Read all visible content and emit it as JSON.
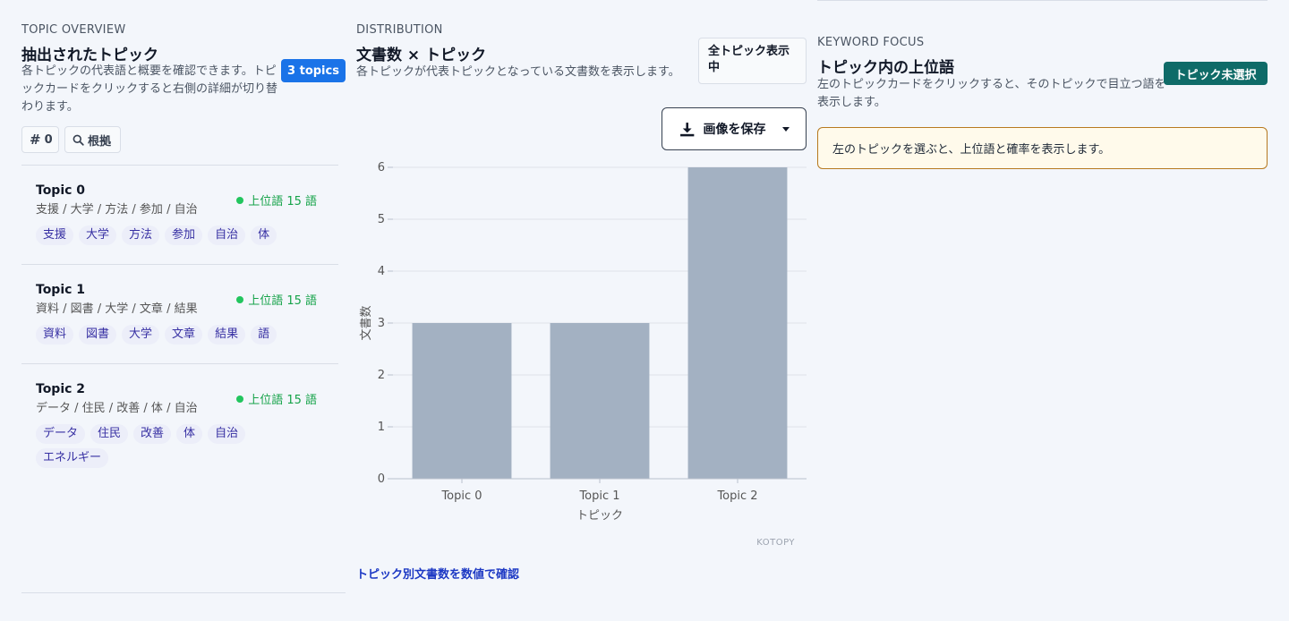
{
  "overview": {
    "eyebrow": "TOPIC OVERVIEW",
    "title": "抽出されたトピック",
    "desc": "各トピックの代表語と概要を確認できます。トピックカードをクリックすると右側の詳細が切り替わります。",
    "badge": "3 topics",
    "hash_label": "0",
    "evidence_label": "根拠",
    "topics": [
      {
        "name": "Topic 0",
        "summary": "支援 / 大学 / 方法 / 参加 / 自治",
        "status": "上位語 15 語",
        "chips": [
          "支援",
          "大学",
          "方法",
          "参加",
          "自治",
          "体"
        ]
      },
      {
        "name": "Topic 1",
        "summary": "資料 / 図書 / 大学 / 文章 / 結果",
        "status": "上位語 15 語",
        "chips": [
          "資料",
          "図書",
          "大学",
          "文章",
          "結果",
          "語"
        ]
      },
      {
        "name": "Topic 2",
        "summary": "データ / 住民 / 改善 / 体 / 自治",
        "status": "上位語 15 語",
        "chips": [
          "データ",
          "住民",
          "改善",
          "体",
          "自治",
          "エネルギー"
        ]
      }
    ]
  },
  "distribution": {
    "eyebrow": "DISTRIBUTION",
    "title": "文書数 × トピック",
    "desc": "各トピックが代表トピックとなっている文書数を表示します。",
    "toggle_label": "全トピック表示中",
    "save_label": "画像を保存",
    "table_link": "トピック別文書数を数値で確認",
    "watermark": "KOTOPY"
  },
  "keyword": {
    "eyebrow": "KEYWORD FOCUS",
    "title": "トピック内の上位語",
    "desc": "左のトピックカードをクリックすると、そのトピックで目立つ語を表示します。",
    "badge": "トピック未選択",
    "notice": "左のトピックを選ぶと、上位語と確率を表示します。"
  },
  "chart_data": {
    "type": "bar",
    "categories": [
      "Topic 0",
      "Topic 1",
      "Topic 2"
    ],
    "values": [
      3,
      3,
      6
    ],
    "xlabel": "トピック",
    "ylabel": "文書数",
    "ylim": [
      0,
      6
    ],
    "yticks": [
      0,
      1,
      2,
      3,
      4,
      5,
      6
    ],
    "grid": true,
    "bar_color": "#a3b1c2"
  },
  "colors": {
    "accent_blue": "#1a73e8",
    "teal_badge": "#0f6b68",
    "status_green": "#16a34a",
    "chip_text": "#3730a3"
  }
}
